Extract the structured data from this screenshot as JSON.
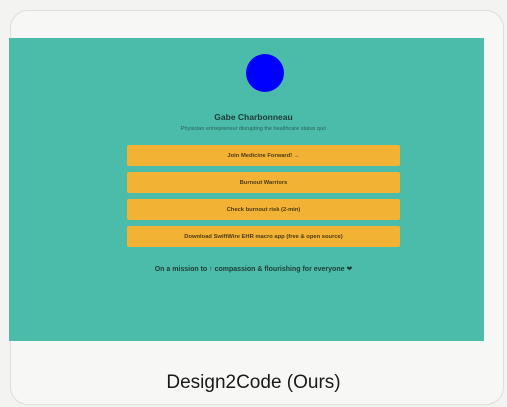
{
  "profile": {
    "name": "Gabe Charbonneau",
    "tagline": "Physician entrepreneur disrupting the healthcare status quo"
  },
  "links": [
    {
      "label": "Join Medicine Forward! →"
    },
    {
      "label": "Burnout Warriors"
    },
    {
      "label": "Check burnout risk (2-min)"
    },
    {
      "label": "Download SwiftWire EHR macro app (free & open source)"
    }
  ],
  "mission": "On a mission to ↑ compassion & flourishing for everyone ❤",
  "caption": "Design2Code (Ours)",
  "colors": {
    "background": "#4bbcaa",
    "button": "#f2b233",
    "avatar": "#0000ff"
  }
}
